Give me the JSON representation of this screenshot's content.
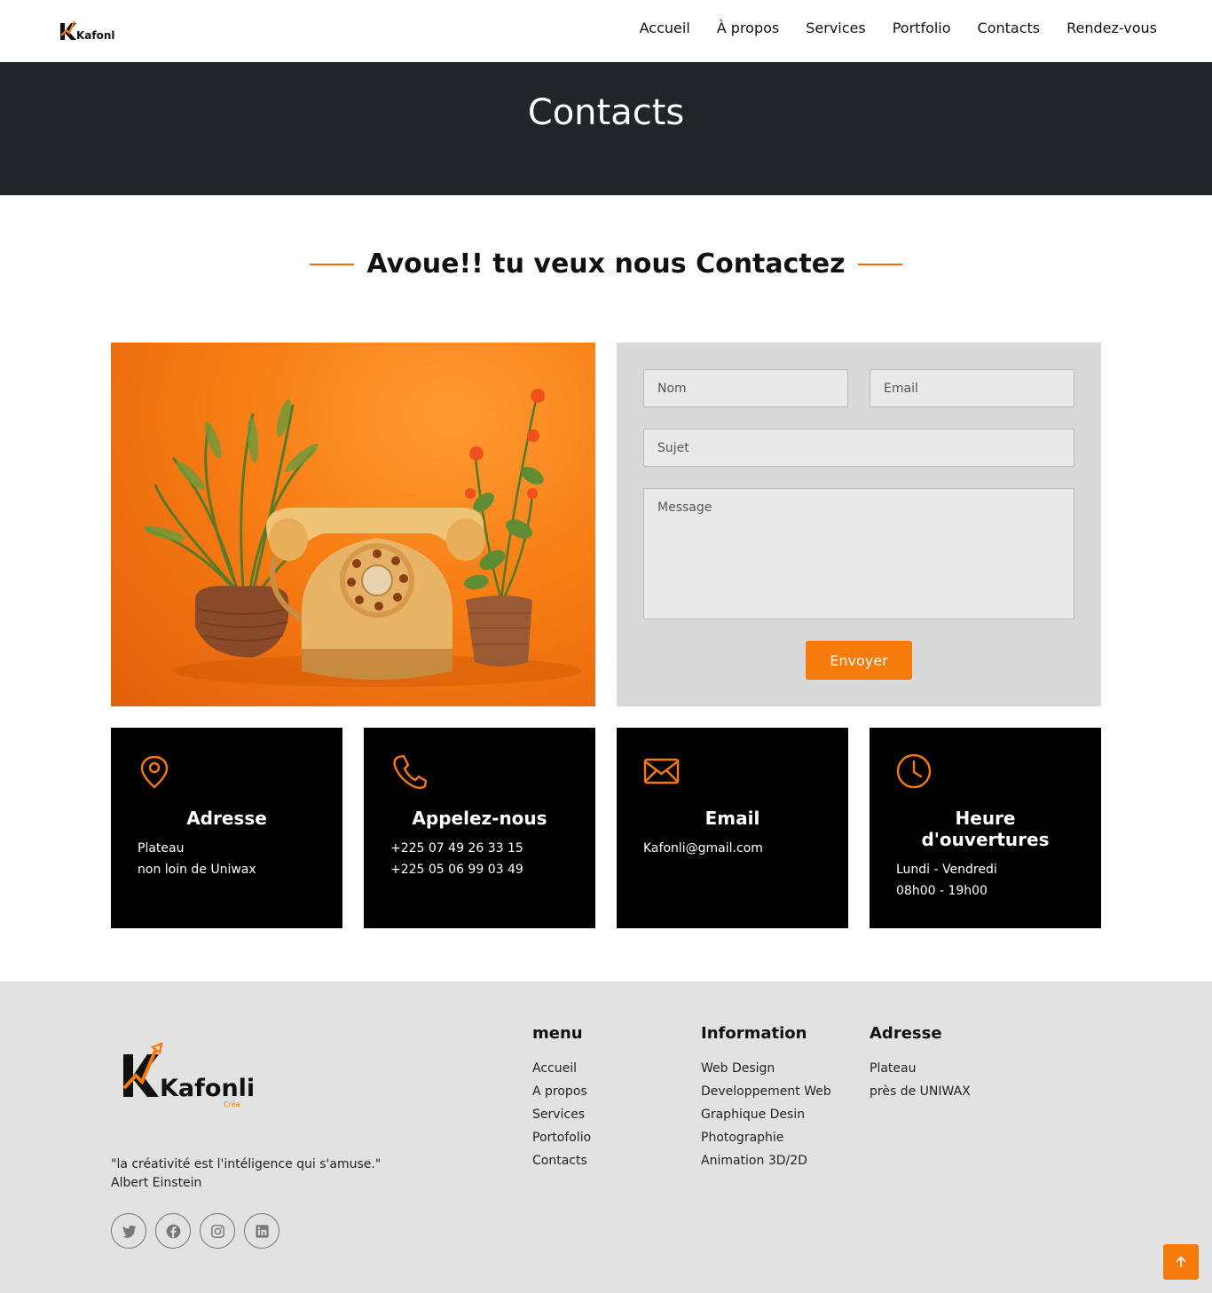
{
  "brand": {
    "logo_text": "Kafonli",
    "logo_sub": "Créa",
    "accent_color": "#f77b0a",
    "dark_color": "#212429"
  },
  "nav": {
    "items": [
      "Accueil",
      "À propos",
      "Services",
      "Portfolio",
      "Contacts",
      "Rendez-vous"
    ]
  },
  "hero": {
    "title": "Contacts"
  },
  "section": {
    "title": "Avoue!! tu veux nous Contactez"
  },
  "form": {
    "name_placeholder": "Nom",
    "email_placeholder": "Email",
    "subject_placeholder": "Sujet",
    "message_placeholder": "Message",
    "submit_label": "Envoyer"
  },
  "cards": [
    {
      "icon": "map-pin-icon",
      "title": "Adresse",
      "lines": [
        "Plateau",
        "non loin de Uniwax"
      ]
    },
    {
      "icon": "phone-icon",
      "title": "Appelez-nous",
      "lines": [
        "+225 07 49 26 33 15",
        "+225 05 06 99 03 49"
      ]
    },
    {
      "icon": "envelope-icon",
      "title": "Email",
      "lines": [
        "Kafonli@gmail.com"
      ]
    },
    {
      "icon": "clock-icon",
      "title": "Heure d'ouvertures",
      "lines": [
        "Lundi - Vendredi",
        "08h00 - 19h00"
      ]
    }
  ],
  "footer": {
    "quote": "\"la créativité est l'intéligence qui s'amuse.\"",
    "quote_author": "Albert Einstein",
    "socials": [
      "twitter-icon",
      "facebook-icon",
      "instagram-icon",
      "linkedin-icon"
    ],
    "menu": {
      "title": "menu",
      "items": [
        "Accueil",
        "A propos",
        "Services",
        "Portofolio",
        "Contacts"
      ]
    },
    "information": {
      "title": "Information",
      "items": [
        "Web Design",
        "Developpement Web",
        "Graphique Desin",
        "Photographie",
        "Animation 3D/2D"
      ]
    },
    "address": {
      "title": "Adresse",
      "items": [
        "Plateau",
        "près de UNIWAX"
      ]
    }
  }
}
